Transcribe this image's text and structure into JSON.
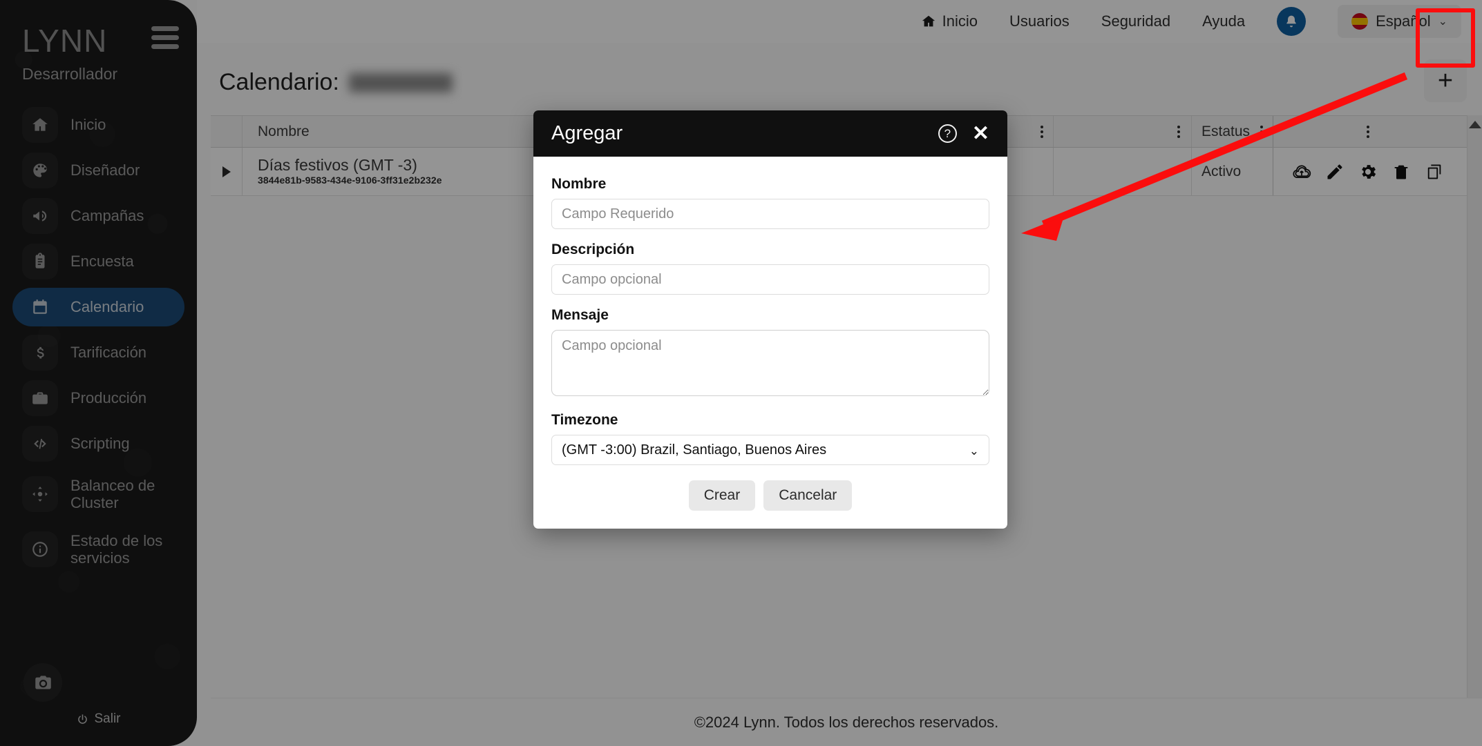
{
  "brand": {
    "logo": "LYNN",
    "subtitle": "Desarrollador"
  },
  "sidebar": {
    "items": [
      {
        "label": "Inicio",
        "icon": "home-icon",
        "active": false
      },
      {
        "label": "Diseñador",
        "icon": "palette-icon",
        "active": false
      },
      {
        "label": "Campañas",
        "icon": "megaphone-icon",
        "active": false
      },
      {
        "label": "Encuesta",
        "icon": "clipboard-icon",
        "active": false
      },
      {
        "label": "Calendario",
        "icon": "calendar-icon",
        "active": true
      },
      {
        "label": "Tarificación",
        "icon": "dollar-icon",
        "active": false
      },
      {
        "label": "Producción",
        "icon": "briefcase-icon",
        "active": false
      },
      {
        "label": "Scripting",
        "icon": "code-icon",
        "active": false
      },
      {
        "label": "Balanceo de Cluster",
        "icon": "cluster-icon",
        "active": false
      },
      {
        "label": "Estado de los servicios",
        "icon": "info-icon",
        "active": false
      }
    ],
    "logout_label": "Salir"
  },
  "topbar": {
    "links": [
      {
        "label": "Inicio",
        "icon": "home-icon"
      },
      {
        "label": "Usuarios",
        "icon": ""
      },
      {
        "label": "Seguridad",
        "icon": ""
      },
      {
        "label": "Ayuda",
        "icon": ""
      }
    ],
    "notification_icon": "bell-icon",
    "language": "Español",
    "language_flag": "spain-flag-icon",
    "language_caret": "⌄"
  },
  "page": {
    "title_prefix": "Calendario:",
    "add_button_label": "+"
  },
  "table": {
    "columns": [
      {
        "key": "expand",
        "label": ""
      },
      {
        "key": "nombre",
        "label": "Nombre"
      },
      {
        "key": "blank",
        "label": ""
      },
      {
        "key": "estatus",
        "label": "Estatus"
      },
      {
        "key": "acciones",
        "label": ""
      }
    ],
    "rows": [
      {
        "expand_icon": "triangle-right-icon",
        "name": "Días festivos (GMT -3)",
        "id": "3844e81b-9583-434e-9106-3ff31e2b232e",
        "status": "Activo",
        "actions": [
          "cloud-upload-icon",
          "pencil-edit-icon",
          "gear-settings-icon",
          "trash-delete-icon",
          "copy-duplicate-icon"
        ]
      }
    ]
  },
  "modal": {
    "title": "Agregar",
    "help_icon": "question-circle-icon",
    "close_icon": "close-icon",
    "fields": {
      "nombre": {
        "label": "Nombre",
        "placeholder": "Campo Requerido",
        "value": ""
      },
      "descripcion": {
        "label": "Descripción",
        "placeholder": "Campo opcional",
        "value": ""
      },
      "mensaje": {
        "label": "Mensaje",
        "placeholder": "Campo opcional",
        "value": ""
      },
      "timezone": {
        "label": "Timezone",
        "selected": "(GMT -3:00) Brazil, Santiago, Buenos Aires",
        "caret": "⌄"
      }
    },
    "submit_label": "Crear",
    "cancel_label": "Cancelar"
  },
  "footer": {
    "text": "©2024 Lynn. Todos los derechos reservados."
  },
  "annotation": {
    "color": "#fb0d0d",
    "type": "arrow-pointing-to-add-button"
  }
}
